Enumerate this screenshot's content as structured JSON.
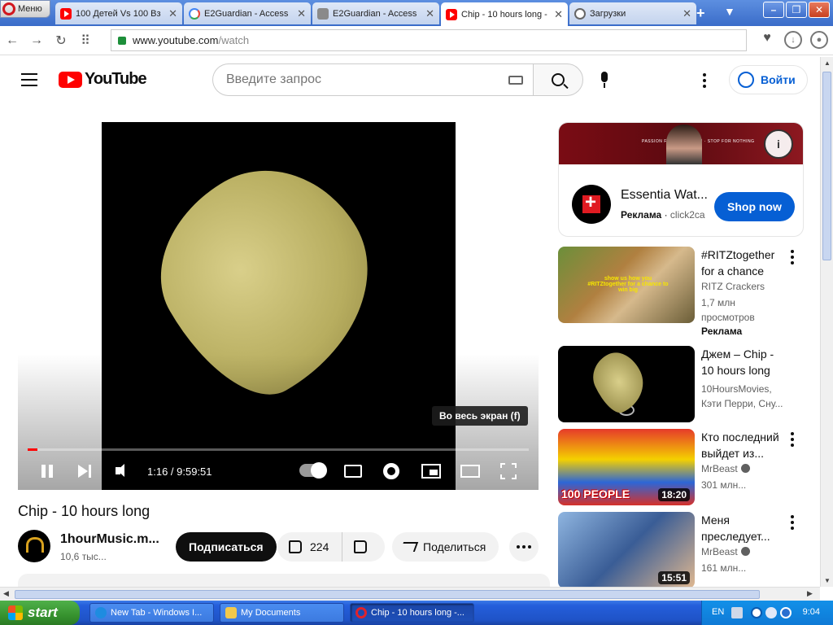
{
  "browser": {
    "menu_label": "Меню",
    "tabs": [
      {
        "label": "100 Детей Vs 100 Вз",
        "favicon": "youtube-icon"
      },
      {
        "label": "E2Guardian - Access",
        "favicon": "google-icon"
      },
      {
        "label": "E2Guardian - Access",
        "favicon": "document-icon"
      },
      {
        "label": "Chip - 10 hours long -",
        "favicon": "youtube-icon",
        "active": true
      },
      {
        "label": "Загрузки",
        "favicon": "download-icon"
      }
    ],
    "url_host": "www.youtube.com",
    "url_path": "/watch"
  },
  "youtube": {
    "logo_text": "YouTube",
    "search_placeholder": "Введите запрос",
    "signin_label": "Войти"
  },
  "player": {
    "tooltip": "Во весь экран (f)",
    "time": "1:16 / 9:59:51",
    "progress_fraction": 0.002
  },
  "video": {
    "title": "Chip - 10 hours long",
    "channel": "1hourMusic.m...",
    "subscribers": "10,6 тыс...",
    "subscribe_label": "Подписаться",
    "likes": "224",
    "share_label": "Поделиться"
  },
  "ad": {
    "banner_text": "PASSION FOR HYDRATION · STOP FOR NOTHING",
    "title": "Essentia Wat...",
    "label": "Реклама",
    "domain": "click2ca",
    "cta": "Shop now"
  },
  "recommendations": [
    {
      "title": "#RITZtogether for a chance to...",
      "channel": "RITZ Crackers",
      "views": "1,7 млн просмотров",
      "ad_label": "Реклама",
      "caption": "show us how you #RITZtogether for a chance to win big"
    },
    {
      "title": "Джем – Chip - 10 hours long",
      "channel": "10HoursMovies, Кэти Перри, Сну..."
    },
    {
      "title": "Кто последний выйдет из...",
      "channel": "MrBeast",
      "views": "301 млн...",
      "duration": "18:20",
      "badge": "100 PEOPLE"
    },
    {
      "title": "Меня преследует...",
      "channel": "MrBeast",
      "views": "161 млн...",
      "duration": "15:51"
    }
  ],
  "taskbar": {
    "start_label": "start",
    "tasks": [
      {
        "label": "New Tab - Windows I..."
      },
      {
        "label": "My Documents"
      },
      {
        "label": "Chip - 10 hours long -..."
      }
    ],
    "lang": "EN",
    "clock": "9:04"
  }
}
